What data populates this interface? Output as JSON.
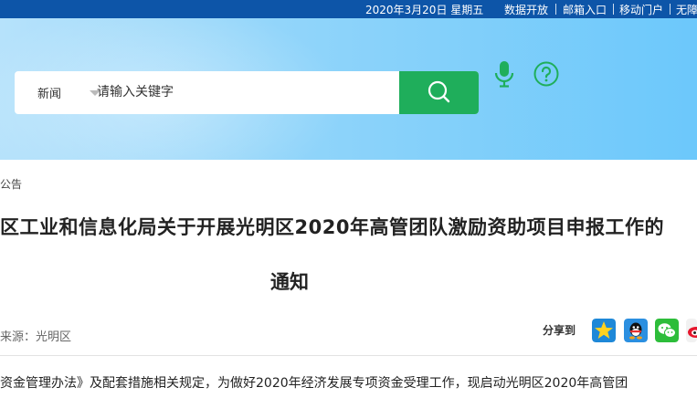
{
  "topbar": {
    "date": "2020年3月20日 星期五",
    "links": [
      "数据开放",
      "邮箱入口",
      "移动门户",
      "无障"
    ]
  },
  "search": {
    "category": "新闻",
    "placeholder": "请输入关键字"
  },
  "icons": {
    "search": "search-icon",
    "mic": "microphone-icon",
    "help": "help-icon"
  },
  "colors": {
    "topbar": "#0d55a8",
    "search_button": "#1fae5b"
  },
  "article": {
    "breadcrumb": "公告",
    "title_line1": "区工业和信息化局关于开展光明区2020年高管团队激励资助项目申报工作的",
    "title_line2": "通知",
    "source": "来源：光明区",
    "share_label": "分享到",
    "body_first_line": "资金管理办法》及配套措施相关规定，为做好2020年经济发展专项资金受理工作，现启动光明区2020年高管团"
  },
  "share": [
    "qzone-icon",
    "qq-icon",
    "wechat-icon",
    "weibo-icon"
  ]
}
